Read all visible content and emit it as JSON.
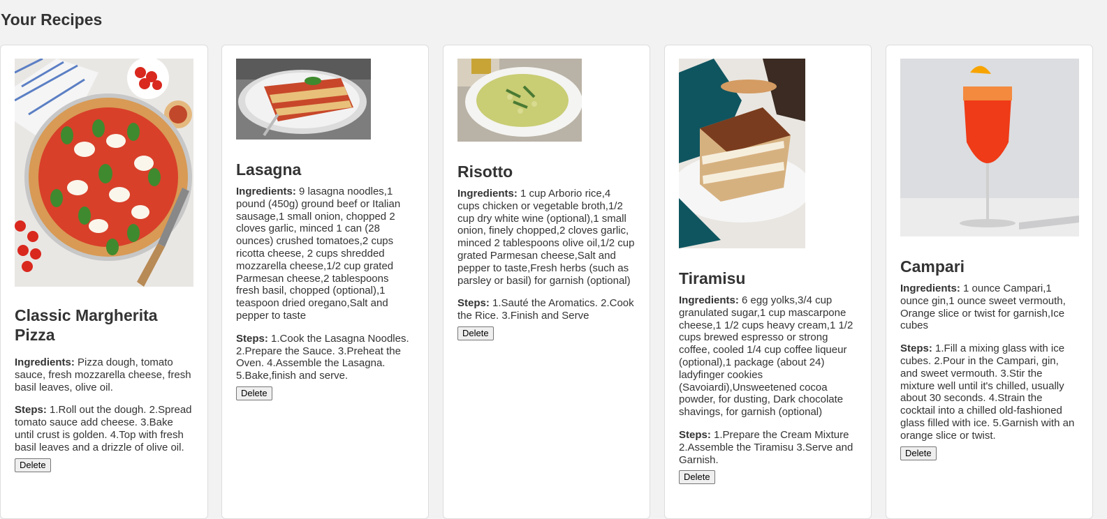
{
  "page": {
    "title": "Your Recipes"
  },
  "labels": {
    "ingredients": "Ingredients:",
    "steps": "Steps:",
    "delete": "Delete"
  },
  "recipes": [
    {
      "title": "Classic Margherita Pizza",
      "ingredients": "Pizza dough, tomato sauce, fresh mozzarella cheese, fresh basil leaves, olive oil.",
      "steps": "1.Roll out the dough. 2.Spread tomato sauce add cheese. 3.Bake until crust is golden. 4.Top with fresh basil leaves and a drizzle of olive oil.",
      "image_icon": "pizza-image"
    },
    {
      "title": "Lasagna",
      "ingredients": "9 lasagna noodles,1 pound (450g) ground beef or Italian sausage,1 small onion, chopped 2 cloves garlic, minced 1 can (28 ounces) crushed tomatoes,2 cups ricotta cheese, 2 cups shredded mozzarella cheese,1/2 cup grated Parmesan cheese,2 tablespoons fresh basil, chopped (optional),1 teaspoon dried oregano,Salt and pepper to taste",
      "steps": "1.Cook the Lasagna Noodles. 2.Prepare the Sauce. 3.Preheat the Oven. 4.Assemble the Lasagna. 5.Bake,finish and serve.",
      "image_icon": "lasagna-image"
    },
    {
      "title": "Risotto",
      "ingredients": "1 cup Arborio rice,4 cups chicken or vegetable broth,1/2 cup dry white wine (optional),1 small onion, finely chopped,2 cloves garlic, minced 2 tablespoons olive oil,1/2 cup grated Parmesan cheese,Salt and pepper to taste,Fresh herbs (such as parsley or basil) for garnish (optional)",
      "steps": "1.Sauté the Aromatics. 2.Cook the Rice. 3.Finish and Serve",
      "image_icon": "risotto-image"
    },
    {
      "title": "Tiramisu",
      "ingredients": "6 egg yolks,3/4 cup granulated sugar,1 cup mascarpone cheese,1 1/2 cups heavy cream,1 1/2 cups brewed espresso or strong coffee, cooled 1/4 cup coffee liqueur (optional),1 package (about 24) ladyfinger cookies (Savoiardi),Unsweetened cocoa powder, for dusting, Dark chocolate shavings, for garnish (optional)",
      "steps": "1.Prepare the Cream Mixture 2.Assemble the Tiramisu 3.Serve and Garnish.",
      "image_icon": "tiramisu-image"
    },
    {
      "title": "Campari",
      "ingredients": "1 ounce Campari,1 ounce gin,1 ounce sweet vermouth, Orange slice or twist for garnish,Ice cubes",
      "steps": "1.Fill a mixing glass with ice cubes. 2.Pour in the Campari, gin, and sweet vermouth. 3.Stir the mixture well until it's chilled, usually about 30 seconds. 4.Strain the cocktail into a chilled old-fashioned glass filled with ice. 5.Garnish with an orange slice or twist.",
      "image_icon": "campari-image"
    }
  ]
}
